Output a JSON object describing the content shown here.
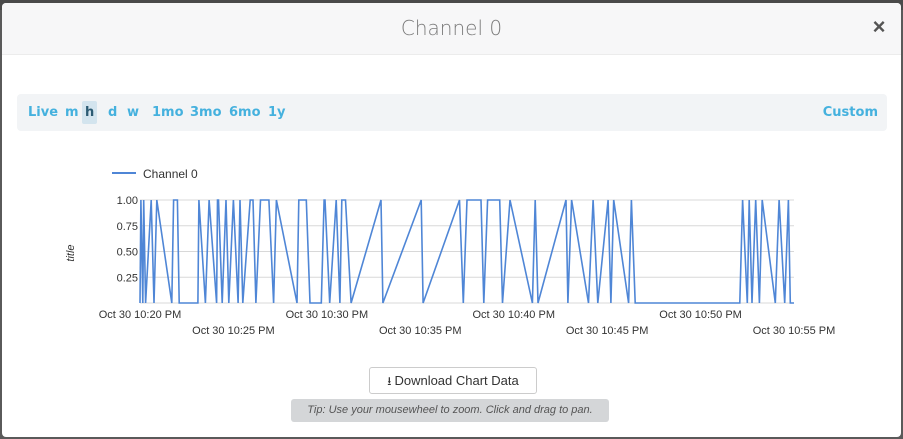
{
  "modal": {
    "title": "Channel 0",
    "close_symbol": "×"
  },
  "range_buttons": [
    "Live",
    "m",
    "h",
    "d",
    "w",
    "1mo",
    "3mo",
    "6mo",
    "1y"
  ],
  "range_active": "h",
  "custom_label": "Custom",
  "download": {
    "label": "Download Chart Data",
    "icon": "download-icon"
  },
  "tip": "Tip: Use your mousewheel to zoom. Click and drag to pan.",
  "colors": {
    "series": "#4f86d6",
    "accent": "#45b1de"
  },
  "chart_data": {
    "type": "line",
    "ylabel": "title",
    "ylim": [
      0,
      1
    ],
    "y_ticks": [
      "0.25",
      "0.50",
      "0.75",
      "1.00"
    ],
    "x_ticks_row1": [
      "Oct 30 10:20 PM",
      "Oct 30 10:30 PM",
      "Oct 30 10:40 PM",
      "Oct 30 10:50 PM"
    ],
    "x_ticks_row2": [
      "Oct 30 10:25 PM",
      "Oct 30 10:35 PM",
      "Oct 30 10:45 PM",
      "Oct 30 10:55 PM"
    ],
    "xlim_minutes_after_10pm": [
      20,
      55
    ],
    "legend": "top-left",
    "grid": true,
    "series": [
      {
        "name": "Channel 0",
        "x_minutes_after_10pm": [
          20.0,
          20.05,
          20.15,
          20.2,
          20.3,
          20.6,
          20.75,
          20.9,
          21.7,
          21.8,
          22.0,
          22.1,
          23.1,
          23.15,
          23.5,
          23.7,
          24.1,
          24.15,
          24.2,
          24.4,
          24.6,
          24.75,
          25.0,
          25.25,
          25.35,
          25.5,
          25.9,
          26.05,
          26.2,
          26.45,
          26.9,
          27.15,
          27.3,
          28.4,
          28.5,
          28.7,
          28.9,
          29.1,
          29.7,
          29.85,
          29.9,
          30.15,
          30.5,
          30.7,
          30.8,
          31.0,
          31.3,
          32.9,
          33.0,
          35.05,
          35.15,
          37.1,
          37.3,
          37.5,
          38.25,
          38.4,
          38.6,
          39.25,
          39.4,
          39.8,
          41.0,
          41.15,
          41.3,
          42.8,
          42.9,
          43.1,
          44.0,
          44.25,
          44.5,
          45.05,
          45.2,
          45.35,
          46.15,
          46.3,
          46.5,
          52.1,
          52.25,
          52.5,
          52.6,
          52.75,
          52.95,
          53.15,
          53.3,
          54.0,
          54.2,
          54.5,
          54.7,
          54.8,
          55.0
        ],
        "y": [
          0,
          1,
          0,
          1,
          0,
          1,
          0,
          1,
          0,
          1,
          1,
          0,
          0,
          1,
          0,
          1,
          0,
          1,
          1,
          0,
          1,
          0,
          1,
          0,
          1,
          0,
          1,
          1,
          0,
          1,
          1,
          0,
          1,
          0,
          1,
          1,
          1,
          0,
          0,
          1,
          1,
          0,
          1,
          0,
          1,
          1,
          0,
          1,
          0,
          1,
          0,
          1,
          0,
          1,
          1,
          0,
          1,
          1,
          0,
          1,
          0,
          1,
          0,
          1,
          0,
          1,
          0,
          1,
          0,
          1,
          0,
          1,
          0,
          1,
          0,
          0,
          1,
          0,
          1,
          0,
          1,
          0,
          1,
          0,
          1,
          0,
          1,
          0,
          0
        ]
      }
    ]
  }
}
